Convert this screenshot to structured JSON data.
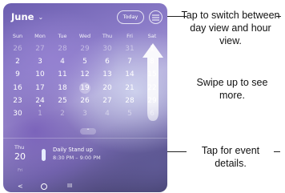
{
  "calendar": {
    "month_label": "June",
    "chevron_icon": "chevron-down-icon",
    "today_label": "Today",
    "view_toggle_icon": "list-view-icon",
    "weekdays": [
      "Sun",
      "Mon",
      "Tue",
      "Wed",
      "Thu",
      "Fri",
      "Sat"
    ],
    "days": [
      {
        "label": "26",
        "muted": true
      },
      {
        "label": "27",
        "muted": true
      },
      {
        "label": "28",
        "muted": true
      },
      {
        "label": "29",
        "muted": true
      },
      {
        "label": "30",
        "muted": true
      },
      {
        "label": "31",
        "muted": true
      },
      {
        "label": "1",
        "muted": false
      },
      {
        "label": "2",
        "muted": false
      },
      {
        "label": "3",
        "muted": false
      },
      {
        "label": "4",
        "muted": false
      },
      {
        "label": "5",
        "muted": false
      },
      {
        "label": "6",
        "muted": false
      },
      {
        "label": "7",
        "muted": false
      },
      {
        "label": "8",
        "muted": false
      },
      {
        "label": "9",
        "muted": false
      },
      {
        "label": "10",
        "muted": false
      },
      {
        "label": "11",
        "muted": false
      },
      {
        "label": "12",
        "muted": false
      },
      {
        "label": "13",
        "muted": false
      },
      {
        "label": "14",
        "muted": false
      },
      {
        "label": "15",
        "muted": false
      },
      {
        "label": "16",
        "muted": false
      },
      {
        "label": "17",
        "muted": false
      },
      {
        "label": "18",
        "muted": false
      },
      {
        "label": "19",
        "muted": false,
        "today": true
      },
      {
        "label": "20",
        "muted": false
      },
      {
        "label": "21",
        "muted": false
      },
      {
        "label": "22",
        "muted": false
      },
      {
        "label": "23",
        "muted": false
      },
      {
        "label": "24",
        "muted": false,
        "dot": true
      },
      {
        "label": "25",
        "muted": false
      },
      {
        "label": "26",
        "muted": false
      },
      {
        "label": "27",
        "muted": false
      },
      {
        "label": "28",
        "muted": false
      },
      {
        "label": "29",
        "muted": false
      },
      {
        "label": "30",
        "muted": false
      },
      {
        "label": "1",
        "muted": true
      },
      {
        "label": "2",
        "muted": true
      },
      {
        "label": "3",
        "muted": true
      },
      {
        "label": "4",
        "muted": true
      },
      {
        "label": "5",
        "muted": true
      },
      {
        "label": "6",
        "muted": true
      }
    ],
    "collapse_icon": "chevron-up-icon"
  },
  "event": {
    "weekday": "Thu",
    "day": "20",
    "title": "Daily Stand up",
    "time": "8:30 PM – 9:00 PM",
    "next_weekday": "Fri"
  },
  "navbar": {
    "back_icon": "back-icon",
    "home_icon": "home-icon",
    "recents_icon": "recents-icon",
    "back_glyph": "<",
    "recents_glyph": "III"
  },
  "callouts": {
    "view_toggle": "Tap to switch between day view and hour view.",
    "swipe_up": "Swipe up to see more.",
    "event_tap": "Tap for event details."
  },
  "colors": {
    "background_top": "#6c5eb0",
    "background_bottom": "#3d3b63",
    "text": "#ffffff",
    "callout_text": "#111111"
  }
}
